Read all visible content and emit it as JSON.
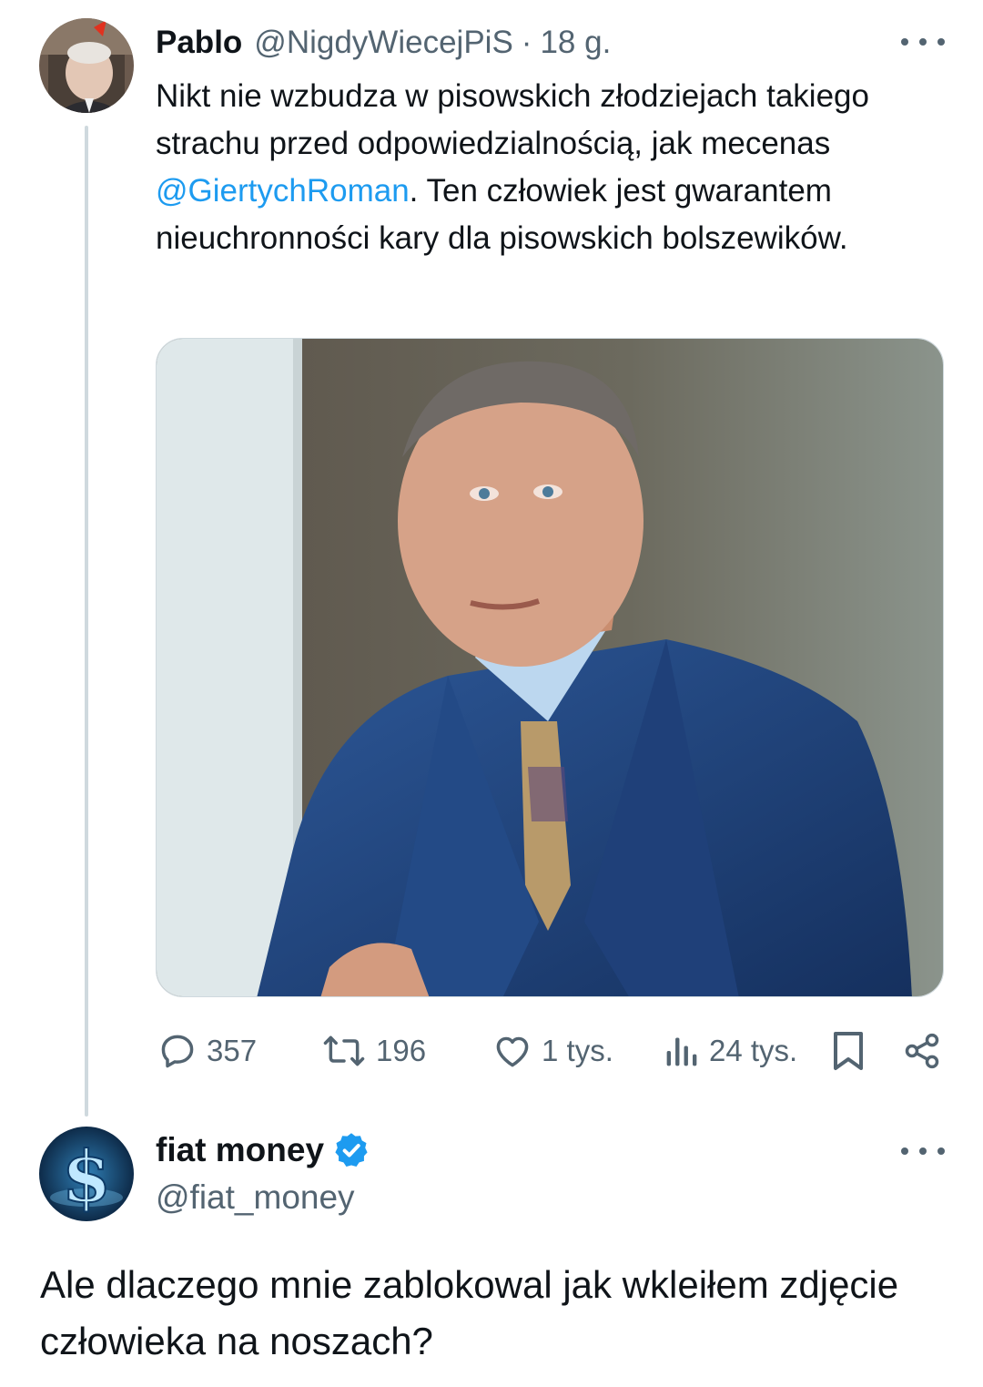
{
  "tweet1": {
    "display_name": "Pablo",
    "handle": "@NigdyWiecejPiS",
    "separator": "·",
    "time": "18 g.",
    "text_before": "Nikt nie wzbudza w pisowskich złodziejach takiego strachu przed odpowiedzialnością, jak mecenas ",
    "mention": "@GiertychRoman",
    "text_after": ". Ten człowiek jest gwarantem nieuchronności kary dla pisowskich bolszewików.",
    "stats": {
      "replies": "357",
      "reposts": "196",
      "likes": "1 tys.",
      "views": "24 tys."
    }
  },
  "tweet2": {
    "display_name": "fiat money",
    "handle": "@fiat_money",
    "text": "Ale dlaczego mnie zablokowal jak wkleiłem zdjęcie człowieka na noszach?"
  },
  "icons": {
    "reply": "speech-bubble-icon",
    "repost": "repost-arrows-icon",
    "like": "heart-icon",
    "views": "bar-chart-icon",
    "bookmark": "bookmark-icon",
    "share": "share-icon",
    "verified": "verified-badge-icon",
    "more": "more-horizontal-icon"
  },
  "colors": {
    "accent": "#1d9bf0",
    "text": "#0f1419",
    "muted": "#536471",
    "thread_line": "#cfd9de"
  }
}
